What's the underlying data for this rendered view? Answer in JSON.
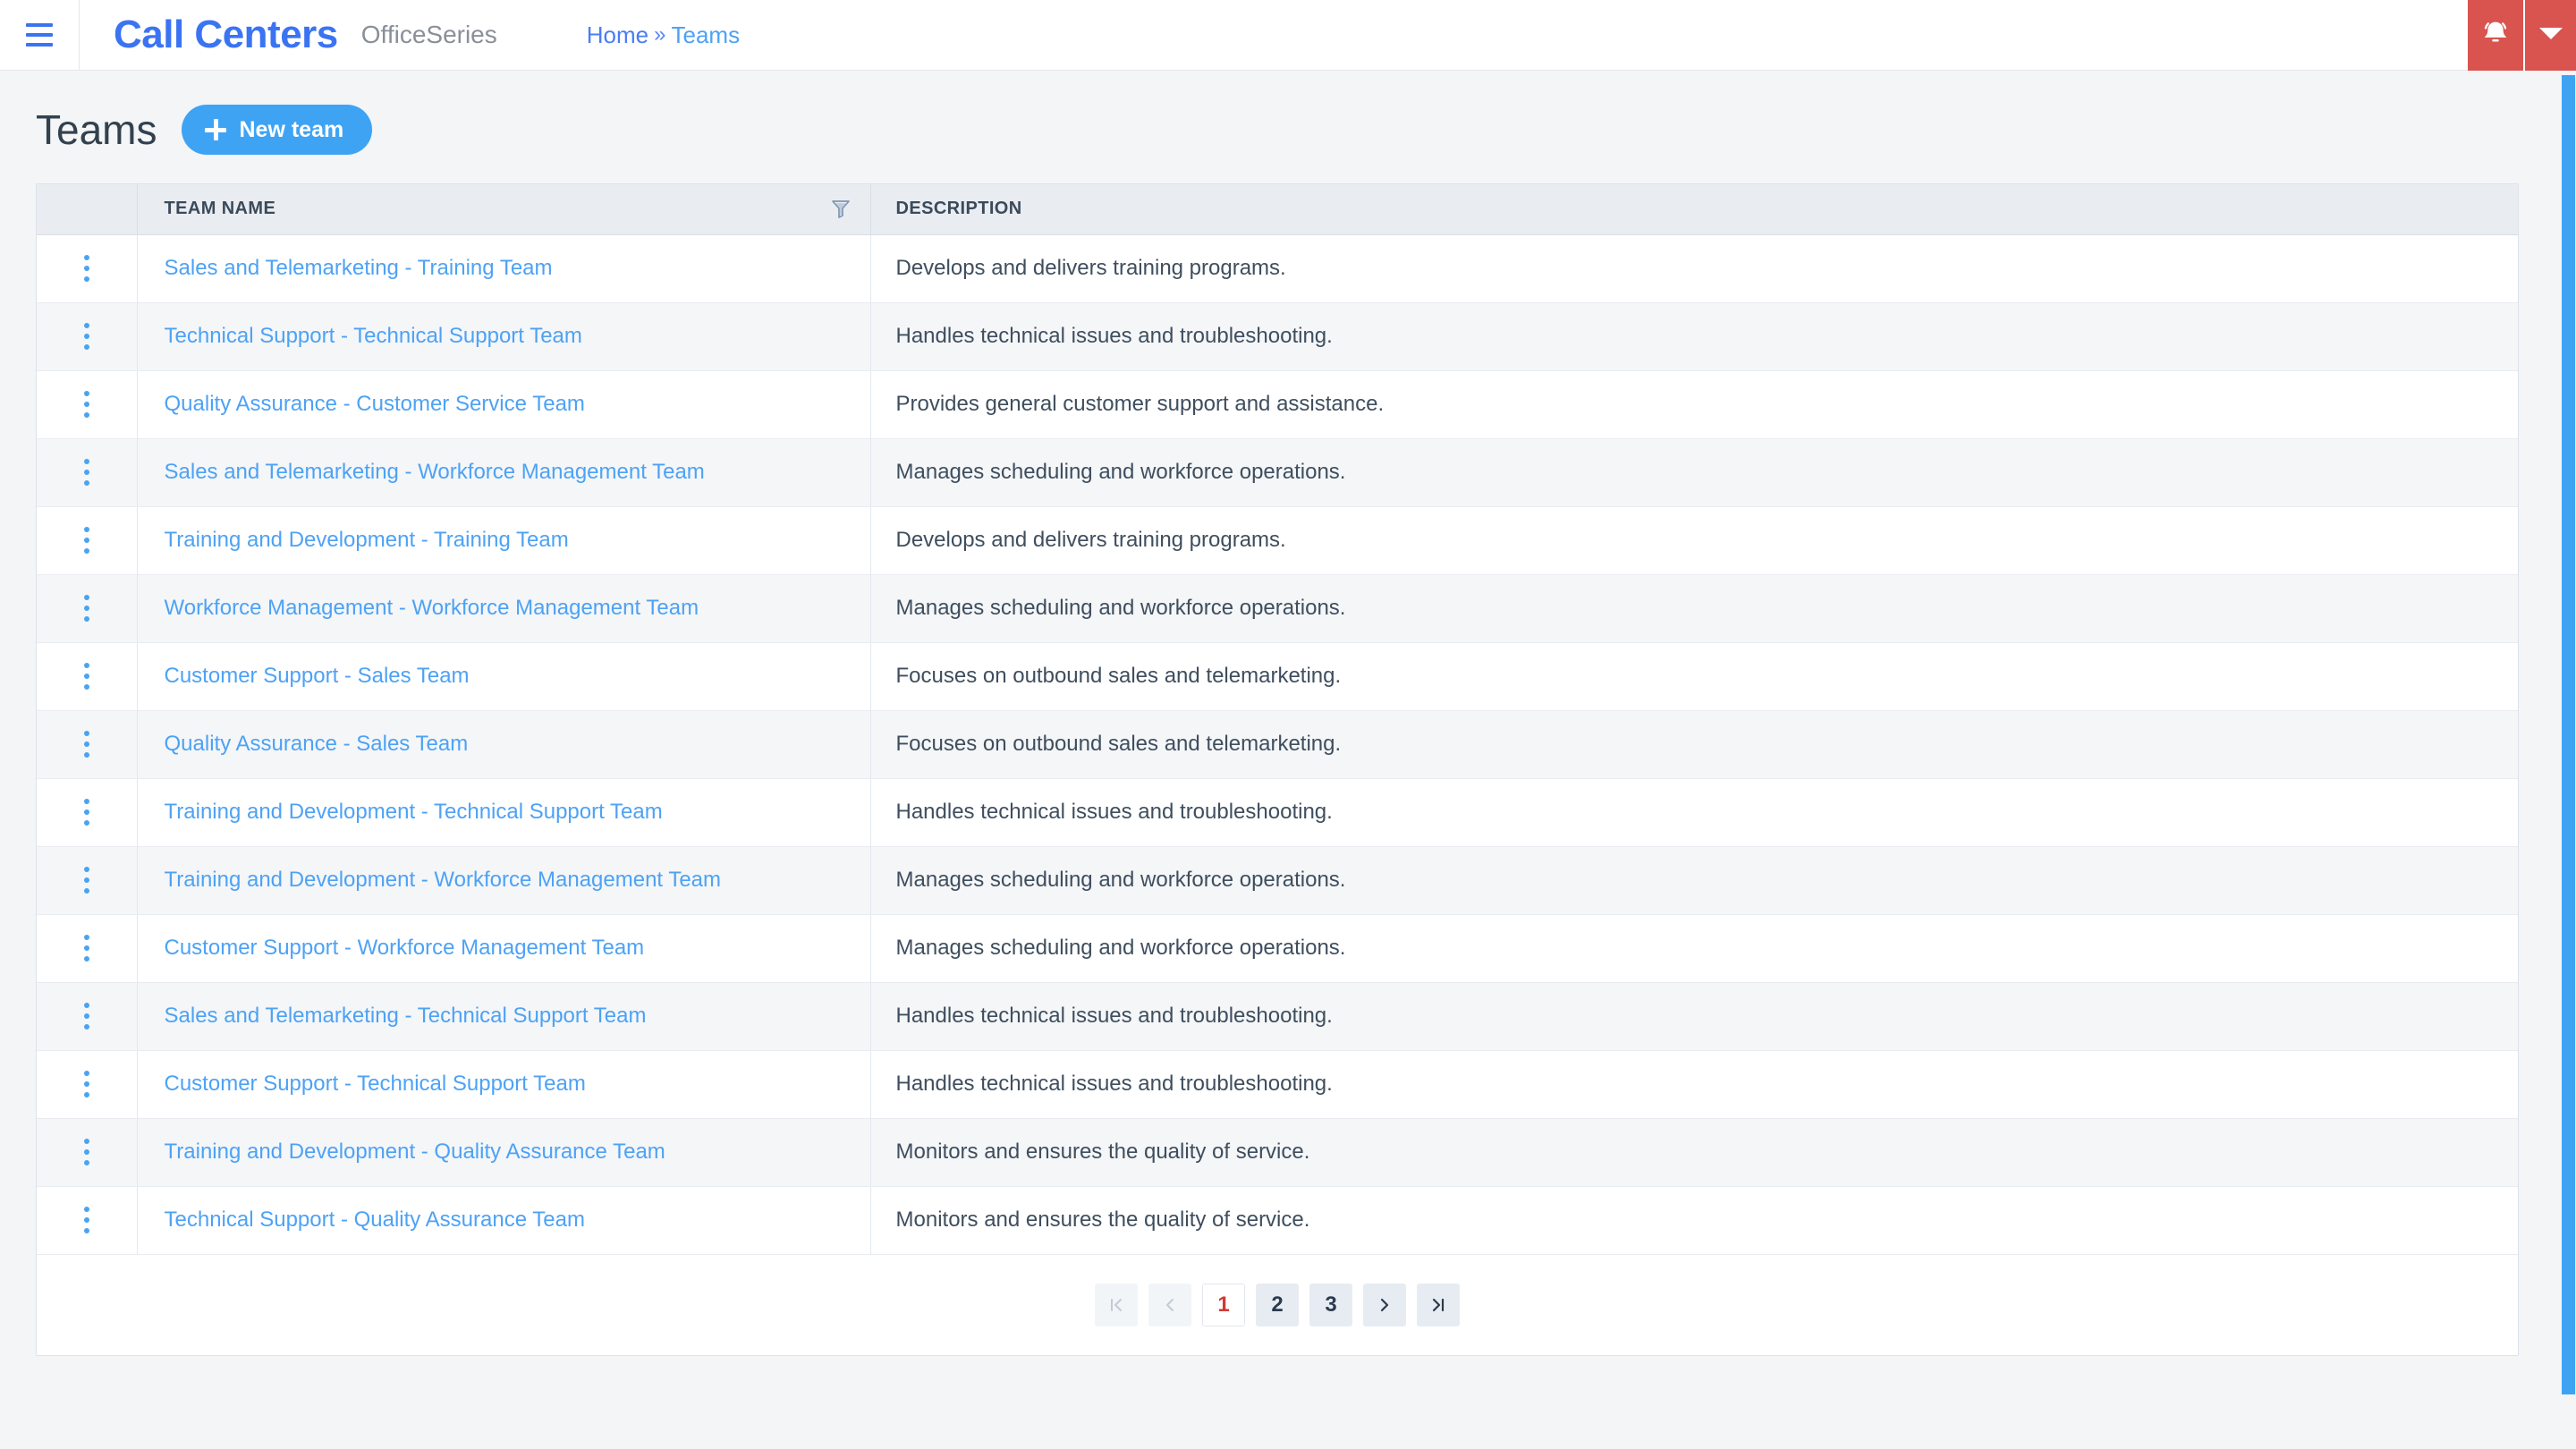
{
  "topbar": {
    "menu_icon": "hamburger-icon",
    "brand": "Call Centers",
    "subbrand": "OfficeSeries",
    "breadcrumb": {
      "home": "Home",
      "separator": "»",
      "current": "Teams"
    },
    "notification_icon": "bell-icon",
    "dropdown_icon": "chevron-down-icon",
    "accent_red": "#d9534f",
    "accent_blue": "#3b74f2"
  },
  "page": {
    "title": "Teams",
    "new_button": {
      "label": "New team",
      "icon": "plus-icon",
      "color": "#3fa3f4"
    }
  },
  "table": {
    "columns": [
      {
        "key": "menu",
        "label": ""
      },
      {
        "key": "name",
        "label": "TEAM NAME",
        "filter_icon": "filter-funnel-icon"
      },
      {
        "key": "desc",
        "label": "DESCRIPTION"
      }
    ],
    "row_menu_icon": "kebab-menu-icon",
    "rows": [
      {
        "name": "Sales and Telemarketing - Training Team",
        "desc": "Develops and delivers training programs."
      },
      {
        "name": "Technical Support - Technical Support Team",
        "desc": "Handles technical issues and troubleshooting."
      },
      {
        "name": "Quality Assurance - Customer Service Team",
        "desc": "Provides general customer support and assistance."
      },
      {
        "name": "Sales and Telemarketing - Workforce Management Team",
        "desc": "Manages scheduling and workforce operations."
      },
      {
        "name": "Training and Development - Training Team",
        "desc": "Develops and delivers training programs."
      },
      {
        "name": "Workforce Management - Workforce Management Team",
        "desc": "Manages scheduling and workforce operations."
      },
      {
        "name": "Customer Support - Sales Team",
        "desc": "Focuses on outbound sales and telemarketing."
      },
      {
        "name": "Quality Assurance - Sales Team",
        "desc": "Focuses on outbound sales and telemarketing."
      },
      {
        "name": "Training and Development - Technical Support Team",
        "desc": "Handles technical issues and troubleshooting."
      },
      {
        "name": "Training and Development - Workforce Management Team",
        "desc": "Manages scheduling and workforce operations."
      },
      {
        "name": "Customer Support - Workforce Management Team",
        "desc": "Manages scheduling and workforce operations."
      },
      {
        "name": "Sales and Telemarketing - Technical Support Team",
        "desc": "Handles technical issues and troubleshooting."
      },
      {
        "name": "Customer Support - Technical Support Team",
        "desc": "Handles technical issues and troubleshooting."
      },
      {
        "name": "Training and Development - Quality Assurance Team",
        "desc": "Monitors and ensures the quality of service."
      },
      {
        "name": "Technical Support - Quality Assurance Team",
        "desc": "Monitors and ensures the quality of service."
      }
    ]
  },
  "pagination": {
    "first_icon": "first-page-icon",
    "prev_icon": "previous-page-icon",
    "pages": [
      "1",
      "2",
      "3"
    ],
    "active_page": "1",
    "next_icon": "next-page-icon",
    "last_icon": "last-page-icon",
    "active_color": "#cf3b33"
  },
  "scrollbar": {
    "thumb_color": "#3fa3f4"
  }
}
